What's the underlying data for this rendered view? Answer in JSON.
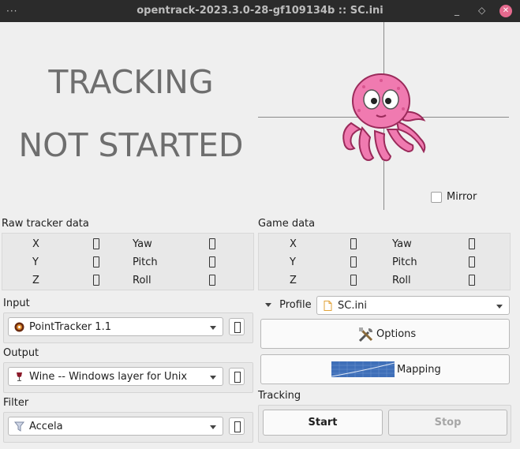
{
  "window": {
    "title": "opentrack-2023.3.0-28-gf109134b :: SC.ini",
    "menu_glyph": "···",
    "minimize_glyph": "_",
    "maximize_glyph": "◇",
    "close_glyph": "✕"
  },
  "status": {
    "line1": "TRACKING",
    "line2": "NOT STARTED"
  },
  "mirror": {
    "label": "Mirror",
    "checked": false
  },
  "raw_tracker": {
    "title": "Raw tracker data",
    "labels": [
      "X",
      "Y",
      "Z",
      "Yaw",
      "Pitch",
      "Roll"
    ]
  },
  "game_data": {
    "title": "Game data",
    "labels": [
      "X",
      "Y",
      "Z",
      "Yaw",
      "Pitch",
      "Roll"
    ]
  },
  "input": {
    "title": "Input",
    "selected": "PointTracker 1.1"
  },
  "output": {
    "title": "Output",
    "selected": "Wine -- Windows layer for Unix"
  },
  "filter": {
    "title": "Filter",
    "selected": "Accela"
  },
  "profile": {
    "label": "Profile",
    "selected": "SC.ini"
  },
  "buttons": {
    "options": "Options",
    "mapping": "Mapping",
    "start": "Start",
    "stop": "Stop"
  },
  "tracking": {
    "title": "Tracking"
  }
}
